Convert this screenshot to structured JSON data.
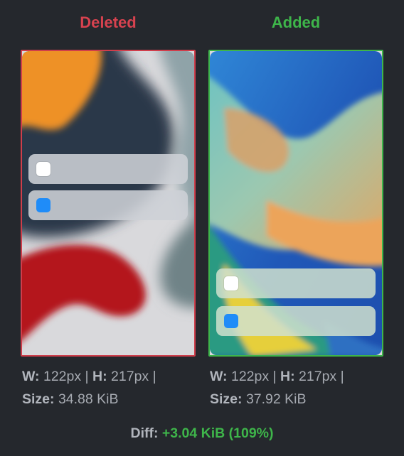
{
  "deleted": {
    "heading": "Deleted",
    "w_label": "W:",
    "w_value": "122px",
    "h_label": "H:",
    "h_value": "217px",
    "size_label": "Size:",
    "size_value": "34.88 KiB"
  },
  "added": {
    "heading": "Added",
    "w_label": "W:",
    "w_value": "122px",
    "h_label": "H:",
    "h_value": "217px",
    "size_label": "Size:",
    "size_value": "37.92 KiB"
  },
  "separator": "|",
  "diff": {
    "label": "Diff:",
    "value": "+3.04 KiB (109%)"
  },
  "colors": {
    "background": "#25282d",
    "deleted": "#d7424f",
    "added": "#3eb54a",
    "toggle_blue": "#1f8cf8",
    "toggle_white": "#ffffff"
  },
  "icons": {
    "widget_1": "white-square-icon",
    "widget_2": "blue-square-icon"
  }
}
